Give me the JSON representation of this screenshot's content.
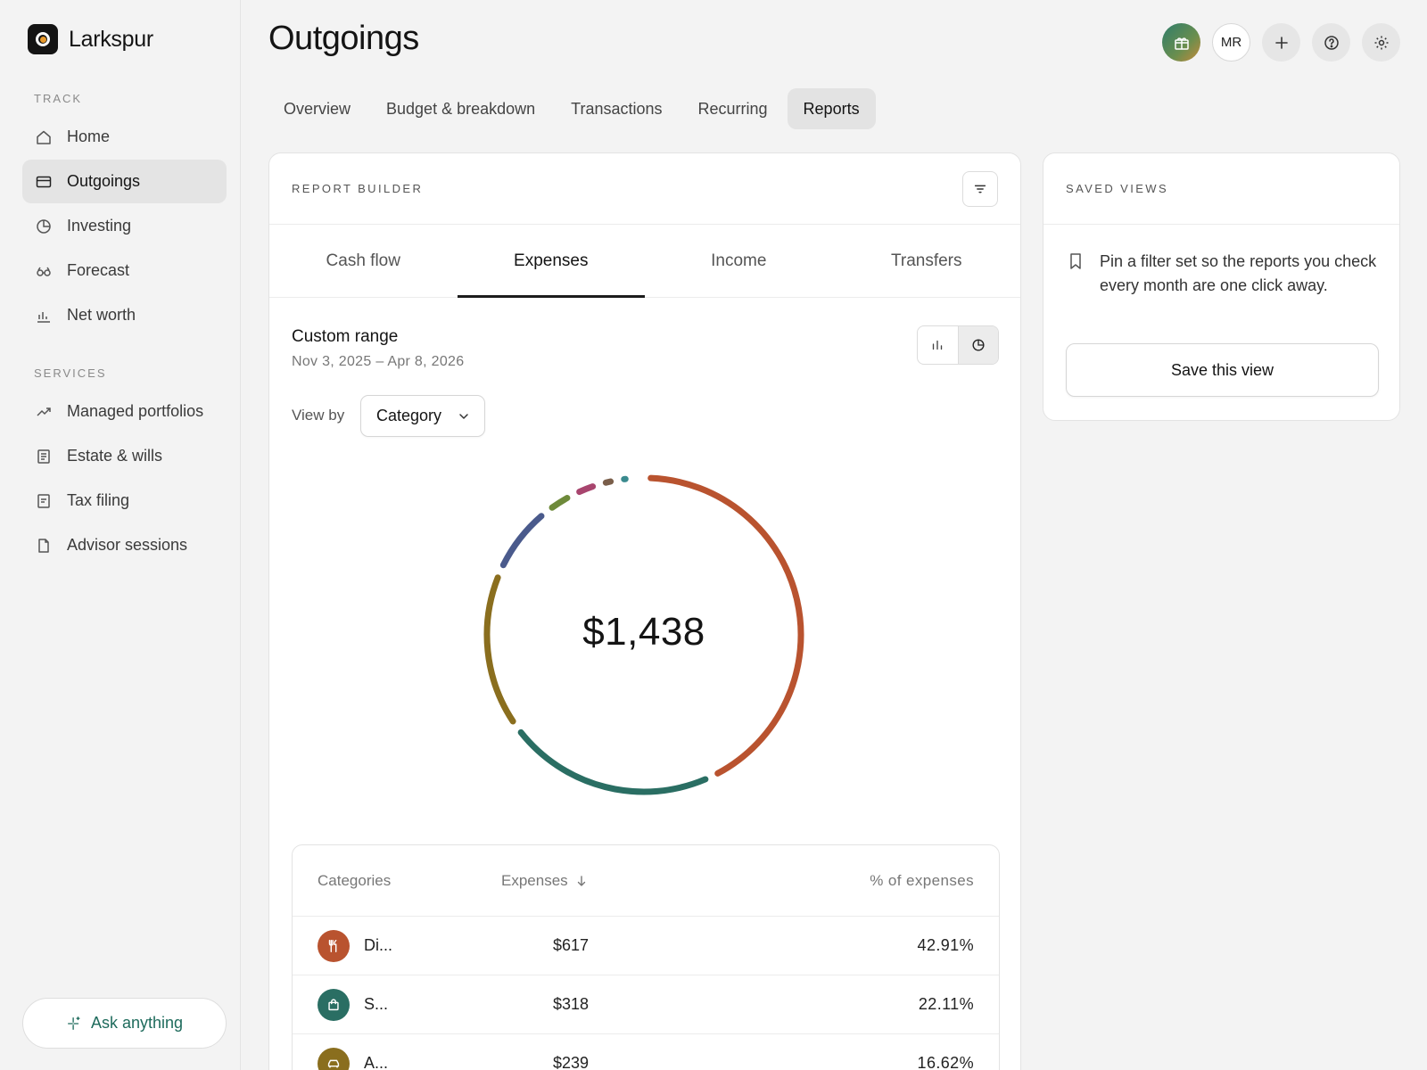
{
  "app": {
    "name": "Larkspur"
  },
  "sidebar": {
    "track_label": "TRACK",
    "services_label": "SERVICES",
    "track_items": [
      {
        "label": "Home",
        "icon": "home-icon"
      },
      {
        "label": "Outgoings",
        "icon": "card-icon",
        "active": true
      },
      {
        "label": "Investing",
        "icon": "pie-icon"
      },
      {
        "label": "Forecast",
        "icon": "binoculars-icon"
      },
      {
        "label": "Net worth",
        "icon": "bar-chart-icon"
      }
    ],
    "service_items": [
      {
        "label": "Managed portfolios",
        "icon": "trend-icon"
      },
      {
        "label": "Estate & wills",
        "icon": "document-icon"
      },
      {
        "label": "Tax filing",
        "icon": "receipt-icon"
      },
      {
        "label": "Advisor sessions",
        "icon": "file-icon"
      }
    ],
    "ask_label": "Ask anything"
  },
  "header": {
    "title": "Outgoings",
    "avatar_initials": "MR"
  },
  "tabs": [
    {
      "label": "Overview"
    },
    {
      "label": "Budget & breakdown"
    },
    {
      "label": "Transactions"
    },
    {
      "label": "Recurring"
    },
    {
      "label": "Reports",
      "active": true
    }
  ],
  "report": {
    "eyebrow": "REPORT BUILDER",
    "sub_tabs": [
      {
        "label": "Cash flow"
      },
      {
        "label": "Expenses",
        "active": true
      },
      {
        "label": "Income"
      },
      {
        "label": "Transfers"
      }
    ],
    "range_title": "Custom range",
    "range_dates": "Nov 3, 2025 – Apr 8, 2026",
    "view_by_label": "View by",
    "view_by_value": "Category",
    "total": "$1,438",
    "table": {
      "headers": {
        "category": "Categories",
        "expenses": "Expenses",
        "percent": "% of expenses"
      },
      "rows": [
        {
          "name": "Di...",
          "amount": "$617",
          "percent": "42.91%",
          "color": "#b9532f",
          "icon": "utensils-icon"
        },
        {
          "name": "S...",
          "amount": "$318",
          "percent": "22.11%",
          "color": "#2a6e63",
          "icon": "shopping-bag-icon"
        },
        {
          "name": "A...",
          "amount": "$239",
          "percent": "16.62%",
          "color": "#8a6e1e",
          "icon": "car-icon"
        }
      ]
    }
  },
  "chart_data": {
    "type": "pie",
    "variant": "donut",
    "total_label": "$1,438",
    "values": [
      617,
      318,
      239,
      111,
      46,
      41,
      27,
      22,
      17
    ],
    "colors": [
      "#b9532f",
      "#2a6e63",
      "#8a6e1e",
      "#4a5a8c",
      "#6e8a3a",
      "#a8456e",
      "#7a5e4a",
      "#3a8a8e",
      "#3a8a8e"
    ]
  },
  "saved_views": {
    "eyebrow": "SAVED VIEWS",
    "description": "Pin a filter set so the reports you check every month are one click away.",
    "button_label": "Save this view"
  }
}
